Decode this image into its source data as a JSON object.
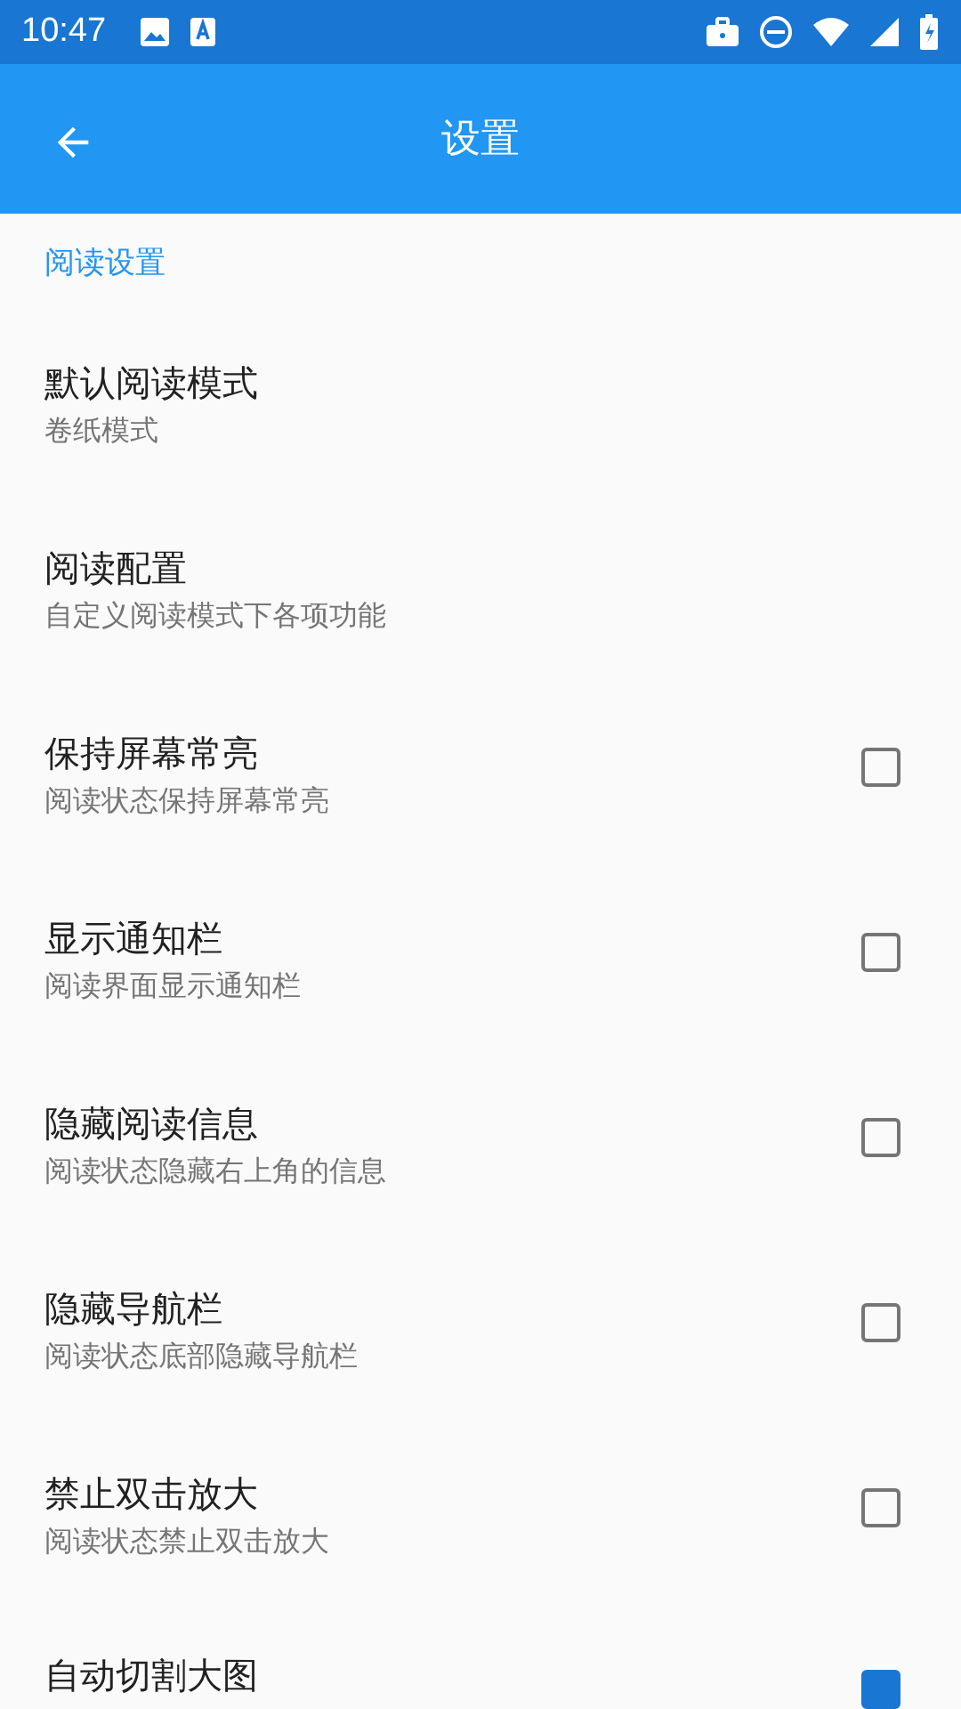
{
  "status_bar": {
    "time": "10:47"
  },
  "toolbar": {
    "title": "设置"
  },
  "section": {
    "title": "阅读设置"
  },
  "items": [
    {
      "kind": "value",
      "title": "默认阅读模式",
      "subtitle": "卷纸模式"
    },
    {
      "kind": "value",
      "title": "阅读配置",
      "subtitle": "自定义阅读模式下各项功能"
    },
    {
      "kind": "checkbox",
      "title": "保持屏幕常亮",
      "subtitle": "阅读状态保持屏幕常亮",
      "checked": false
    },
    {
      "kind": "checkbox",
      "title": "显示通知栏",
      "subtitle": "阅读界面显示通知栏",
      "checked": false
    },
    {
      "kind": "checkbox",
      "title": "隐藏阅读信息",
      "subtitle": "阅读状态隐藏右上角的信息",
      "checked": false
    },
    {
      "kind": "checkbox",
      "title": "隐藏导航栏",
      "subtitle": "阅读状态底部隐藏导航栏",
      "checked": false
    },
    {
      "kind": "checkbox",
      "title": "禁止双击放大",
      "subtitle": "阅读状态禁止双击放大",
      "checked": false
    },
    {
      "kind": "checkbox",
      "title": "自动切割大图",
      "checked": true
    }
  ]
}
